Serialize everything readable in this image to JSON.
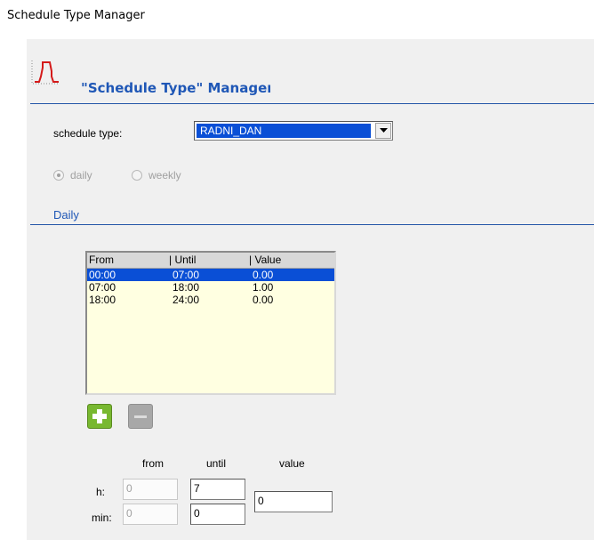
{
  "window": {
    "title": "Schedule Type Manager"
  },
  "header": {
    "title_main": "\"Schedule Type\" Manage",
    "title_tail": "r"
  },
  "schedule_type": {
    "label": "schedule type:",
    "value": "RADNI_DAN"
  },
  "period": {
    "options": [
      {
        "label": "daily",
        "checked": true
      },
      {
        "label": "weekly",
        "checked": false
      }
    ]
  },
  "section": {
    "title": "Daily"
  },
  "table": {
    "headers": [
      "From",
      "| Until",
      "| Value"
    ],
    "rows": [
      {
        "from": "00:00",
        "until": "07:00",
        "value": "0.00",
        "selected": true
      },
      {
        "from": "07:00",
        "until": "18:00",
        "value": "1.00",
        "selected": false
      },
      {
        "from": "18:00",
        "until": "24:00",
        "value": "0.00",
        "selected": false
      }
    ]
  },
  "editor": {
    "col_from": "from",
    "col_until": "until",
    "col_value": "value",
    "row_h": "h:",
    "row_min": "min:",
    "from_h": "0",
    "from_min": "0",
    "until_h": "7",
    "until_min": "0",
    "value": "0"
  },
  "colors": {
    "accent": "#1f57b6",
    "selection": "#0a4fd6",
    "list_bg": "#ffffe1",
    "add_button": "#78b830",
    "remove_button": "#a8a8a8"
  },
  "icons": {
    "header": "schedule-graph-icon",
    "add": "plus-icon",
    "remove": "minus-icon",
    "dropdown": "chevron-down-icon"
  }
}
